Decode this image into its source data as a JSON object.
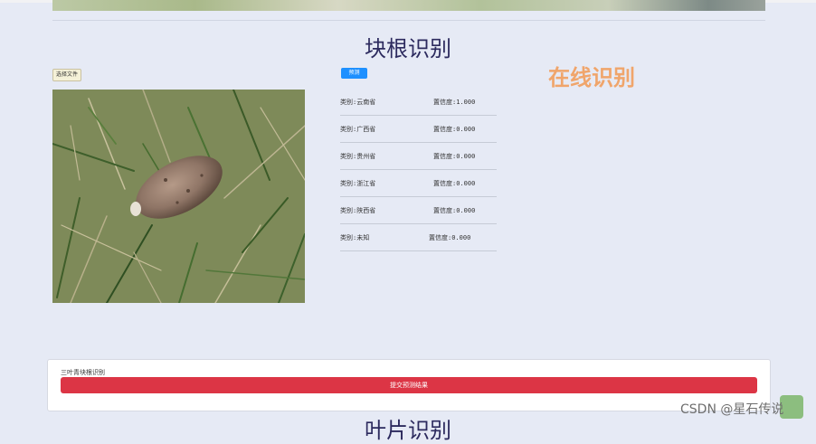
{
  "root_section": {
    "title": "块根识别",
    "online_label": "在线识别",
    "file_button_label": "选择文件",
    "predict_button_label": "预测",
    "results": [
      {
        "class_text": "类别:云南省",
        "confidence_text": "置信度:1.000"
      },
      {
        "class_text": "类别:广西省",
        "confidence_text": "置信度:0.000"
      },
      {
        "class_text": "类别:贵州省",
        "confidence_text": "置信度:0.000"
      },
      {
        "class_text": "类别:浙江省",
        "confidence_text": "置信度:0.000"
      },
      {
        "class_text": "类别:陕西省",
        "confidence_text": "置信度:0.000"
      },
      {
        "class_text": "类别:未知",
        "confidence_text": "置信度:0.000"
      }
    ]
  },
  "submit_panel": {
    "label": "三叶青块根识别",
    "submit_button_label": "提交预测结果"
  },
  "leaf_section": {
    "title": "叶片识别"
  },
  "watermark": "CSDN @星石传说",
  "colors": {
    "background": "#e6eaf5",
    "title": "#2c2a5e",
    "online_label": "#f0a56b",
    "predict_button": "#1e90ff",
    "submit_button": "#dc3545"
  }
}
